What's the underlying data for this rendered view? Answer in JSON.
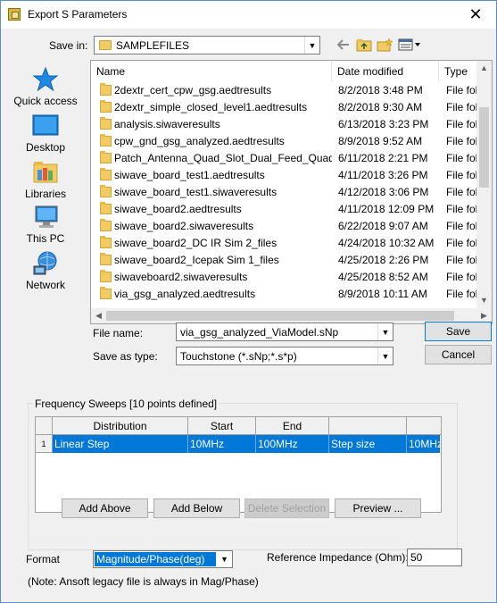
{
  "window": {
    "title": "Export S Parameters",
    "close_glyph": "✕"
  },
  "save_in": {
    "label": "Save in:",
    "value": "SAMPLEFILES"
  },
  "places": [
    {
      "label": "Quick access",
      "icon": "star-icon"
    },
    {
      "label": "Desktop",
      "icon": "desktop-icon"
    },
    {
      "label": "Libraries",
      "icon": "libraries-icon"
    },
    {
      "label": "This PC",
      "icon": "computer-icon"
    },
    {
      "label": "Network",
      "icon": "network-icon"
    }
  ],
  "file_list": {
    "columns": [
      "Name",
      "Date modified",
      "Type"
    ],
    "rows": [
      {
        "name": "2dextr_cert_cpw_gsg.aedtresults",
        "date": "8/2/2018 3:48 PM",
        "type": "File fol"
      },
      {
        "name": "2dextr_simple_closed_level1.aedtresults",
        "date": "8/2/2018 9:30 AM",
        "type": "File fol"
      },
      {
        "name": "analysis.siwaveresults",
        "date": "6/13/2018 3:23 PM",
        "type": "File fol"
      },
      {
        "name": "cpw_gnd_gsg_analyzed.aedtresults",
        "date": "8/9/2018 9:52 AM",
        "type": "File fol"
      },
      {
        "name": "Patch_Antenna_Quad_Slot_Dual_Feed_Quad...",
        "date": "6/11/2018 2:21 PM",
        "type": "File fol"
      },
      {
        "name": "siwave_board_test1.aedtresults",
        "date": "4/11/2018 3:26 PM",
        "type": "File fol"
      },
      {
        "name": "siwave_board_test1.siwaveresults",
        "date": "4/12/2018 3:06 PM",
        "type": "File fol"
      },
      {
        "name": "siwave_board2.aedtresults",
        "date": "4/11/2018 12:09 PM",
        "type": "File fol"
      },
      {
        "name": "siwave_board2.siwaveresults",
        "date": "6/22/2018 9:07 AM",
        "type": "File fol"
      },
      {
        "name": "siwave_board2_DC IR Sim 2_files",
        "date": "4/24/2018 10:32 AM",
        "type": "File fol"
      },
      {
        "name": "siwave_board2_Icepak Sim 1_files",
        "date": "4/25/2018 2:26 PM",
        "type": "File fol"
      },
      {
        "name": "siwaveboard2.siwaveresults",
        "date": "4/25/2018 8:52 AM",
        "type": "File fol"
      },
      {
        "name": "via_gsg_analyzed.aedtresults",
        "date": "8/9/2018 10:11 AM",
        "type": "File fol"
      }
    ]
  },
  "file_name": {
    "label": "File name:",
    "value": "via_gsg_analyzed_ViaModel.sNp"
  },
  "save_as_type": {
    "label": "Save as type:",
    "value": "Touchstone (*.sNp;*.s*p)"
  },
  "buttons": {
    "save": "Save",
    "cancel": "Cancel"
  },
  "sweeps": {
    "title": "Frequency Sweeps [10 points defined]",
    "headers": [
      "Distribution",
      "Start",
      "End",
      "",
      ""
    ],
    "rows": [
      {
        "index": "1",
        "distribution": "Linear Step",
        "start": "10MHz",
        "end": "100MHz",
        "param": "Step size",
        "param_value": "10MHz"
      }
    ],
    "add_above": "Add Above",
    "add_below": "Add Below",
    "delete_selection": "Delete Selection",
    "preview": "Preview ..."
  },
  "format": {
    "label": "Format",
    "value": "Magnitude/Phase(deg)"
  },
  "reference_impedance": {
    "label": "Reference Impedance (Ohm):",
    "value": "50"
  },
  "note": "(Note: Ansoft legacy file is always in Mag/Phase)",
  "colors": {
    "accent": "#0078d7",
    "folder": "#f2cc63"
  }
}
